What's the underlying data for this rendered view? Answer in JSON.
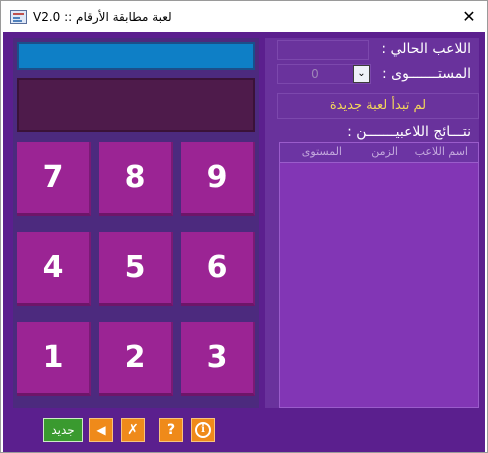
{
  "window": {
    "title": "V2.0 :: لعبة مطابقة الأرقام",
    "close_glyph": "✕"
  },
  "keypad": {
    "keys": [
      "7",
      "8",
      "9",
      "4",
      "5",
      "6",
      "1",
      "2",
      "3"
    ]
  },
  "info": {
    "current_player_label": "اللاعب الحالي :",
    "level_label": "المستـــــــوى :",
    "level_value": "0",
    "level_arrow": "⌄",
    "status_text": "لم تبدأ لعبة جديدة",
    "results_label": "نتـــائج اللاعبيـــــــن :",
    "columns": [
      "اسم اللاعب",
      "الزمن",
      "المستوى"
    ]
  },
  "toolbar": {
    "new_label": "جديد",
    "back_glyph": "◀",
    "cancel_glyph": "✗",
    "help_glyph": "?",
    "info_glyph": "i"
  },
  "colors": {
    "background": "#5b1f8e",
    "key": "#9b2494",
    "display_blue": "#0e7fc6",
    "status_text": "#f4d75a",
    "new_button": "#3a9a2f",
    "orange_button": "#ef8a1a"
  }
}
